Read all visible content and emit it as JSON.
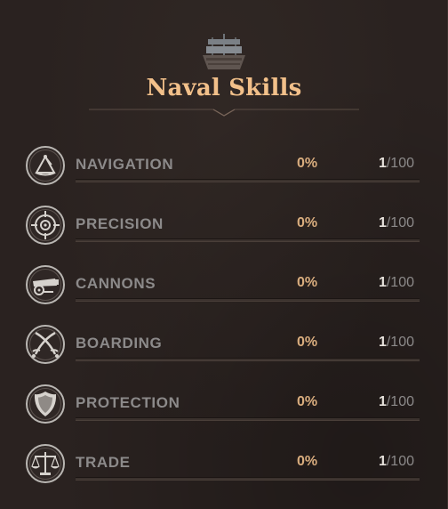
{
  "header": {
    "title": "Naval Skills",
    "emblem_icon": "ship-icon"
  },
  "colors": {
    "background": "#2a2220",
    "title": "#f2c08a",
    "percent": "#d9ad7e",
    "label": "#8c8a8a"
  },
  "skills": [
    {
      "name": "NAVIGATION",
      "icon": "sextant-icon",
      "percent": "0%",
      "progress": 0,
      "level_current": "1",
      "level_max": "/100"
    },
    {
      "name": "PRECISION",
      "icon": "crosshair-icon",
      "percent": "0%",
      "progress": 0,
      "level_current": "1",
      "level_max": "/100"
    },
    {
      "name": "CANNONS",
      "icon": "cannon-icon",
      "percent": "0%",
      "progress": 0,
      "level_current": "1",
      "level_max": "/100"
    },
    {
      "name": "BOARDING",
      "icon": "crossed-swords-icon",
      "percent": "0%",
      "progress": 0,
      "level_current": "1",
      "level_max": "/100"
    },
    {
      "name": "PROTECTION",
      "icon": "shield-icon",
      "percent": "0%",
      "progress": 0,
      "level_current": "1",
      "level_max": "/100"
    },
    {
      "name": "TRADE",
      "icon": "scales-icon",
      "percent": "0%",
      "progress": 0,
      "level_current": "1",
      "level_max": "/100"
    }
  ]
}
